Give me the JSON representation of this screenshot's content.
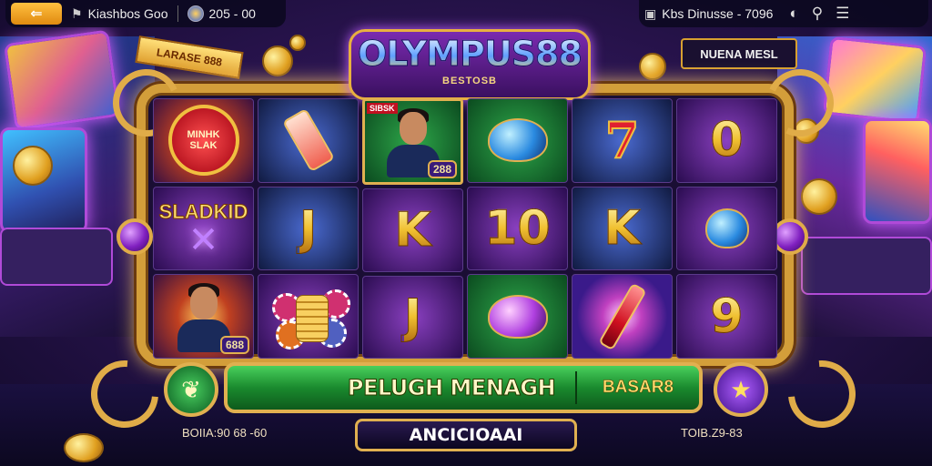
{
  "topbar": {
    "back_arrow": "⇐",
    "player_name": "Kiashbos Goo",
    "balance": "205 - 00",
    "info": "Kbs Dinusse - 7096"
  },
  "logo": {
    "title": "OLYMPUS88",
    "subtitle": "BESTOSB"
  },
  "top_badge": "NUENA MESL",
  "ribbon": "LARASE 888",
  "reels": {
    "badge_lines": [
      "MINHK",
      "SLAK"
    ],
    "slad_text": "SLADKID",
    "portrait_tag": "688",
    "portrait_tag_small": "288",
    "corner_tag": "SIBSK",
    "letters": {
      "j1": "J",
      "k1": "K",
      "j2": "J",
      "ten": "10",
      "k2": "K",
      "zero": "0",
      "nine": "9"
    }
  },
  "controls": {
    "main_label": "PELUGH MENAGH",
    "value": "BASAR8",
    "bottom_button": "ANCICIOAAI",
    "stat_left": "BOIIA:90 68 -60",
    "stat_right": "TOIB.Z9-83"
  },
  "icons": {
    "back": "arrow-left-icon",
    "user": "user-icon",
    "globe": "coin-icon",
    "book": "book-icon",
    "ball": "ball-icon",
    "search": "search-icon",
    "menu": "menu-icon",
    "spin": "leaf-icon",
    "star": "star-icon"
  },
  "colors": {
    "accent_gold": "#e0b050",
    "bar_green": "#1a8a2e",
    "purple": "#7a2ab0"
  }
}
